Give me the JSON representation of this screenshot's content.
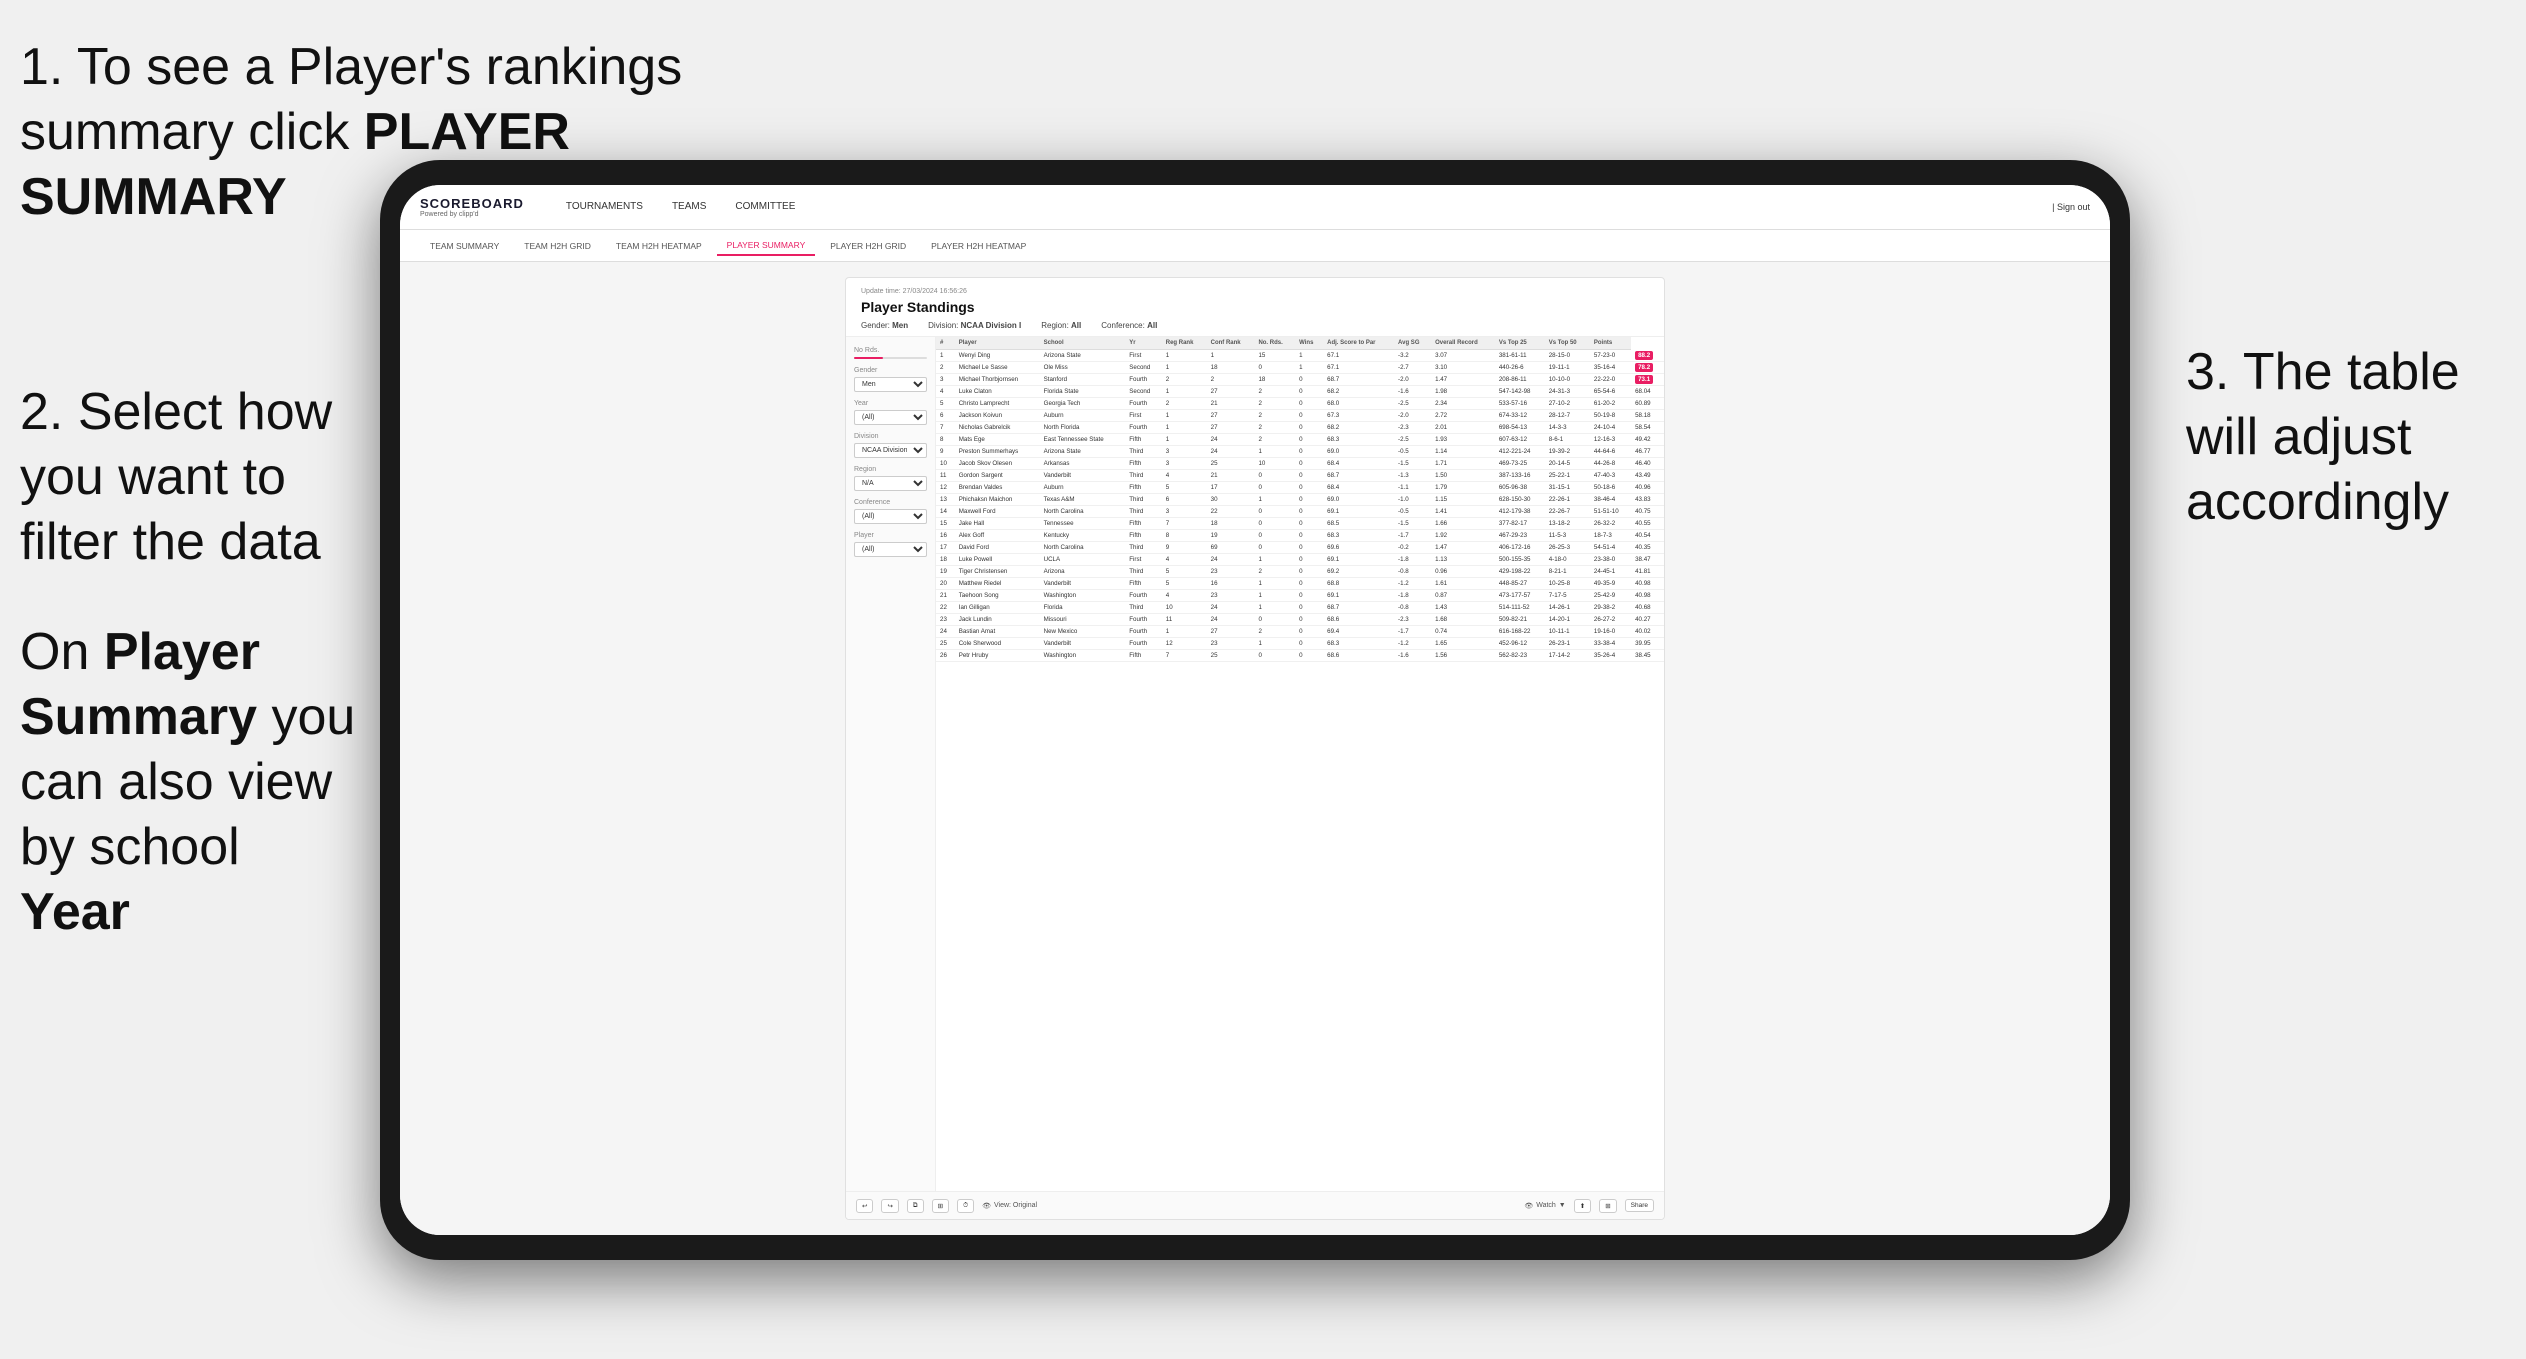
{
  "annotations": {
    "top_left": {
      "number": "1.",
      "text": "To see a Player's rankings summary click ",
      "bold": "PLAYER SUMMARY"
    },
    "mid_left": {
      "number": "2.",
      "text": "Select how you want to filter the data"
    },
    "bottom_left": {
      "text_prefix": "On ",
      "bold1": "Player Summary",
      "text_mid": " you can also view by school ",
      "bold2": "Year"
    },
    "right": {
      "number": "3.",
      "text": "The table will adjust accordingly"
    }
  },
  "app": {
    "logo": "SCOREBOARD",
    "logo_sub": "Powered by clipp'd",
    "nav": [
      {
        "label": "TOURNAMENTS",
        "active": false
      },
      {
        "label": "TEAMS",
        "active": false
      },
      {
        "label": "COMMITTEE",
        "active": false
      }
    ],
    "header_right": "| Sign out",
    "sub_nav": [
      {
        "label": "TEAM SUMMARY",
        "active": false
      },
      {
        "label": "TEAM H2H GRID",
        "active": false
      },
      {
        "label": "TEAM H2H HEATMAP",
        "active": false
      },
      {
        "label": "PLAYER SUMMARY",
        "active": true
      },
      {
        "label": "PLAYER H2H GRID",
        "active": false
      },
      {
        "label": "PLAYER H2H HEATMAP",
        "active": false
      }
    ]
  },
  "standings": {
    "update_time": "Update time:",
    "update_date": "27/03/2024 16:56:26",
    "title": "Player Standings",
    "filters": {
      "gender_label": "Gender:",
      "gender_value": "Men",
      "division_label": "Division:",
      "division_value": "NCAA Division I",
      "region_label": "Region:",
      "region_value": "All",
      "conference_label": "Conference:",
      "conference_value": "All"
    },
    "sidebar": {
      "no_rds_label": "No Rds.",
      "gender_label": "Gender",
      "gender_value": "Men",
      "year_label": "Year",
      "year_value": "(All)",
      "division_label": "Division",
      "division_value": "NCAA Division I",
      "region_label": "Region",
      "region_value": "N/A",
      "conference_label": "Conference",
      "conference_value": "(All)",
      "player_label": "Player",
      "player_value": "(All)"
    },
    "table_headers": [
      "#",
      "Player",
      "School",
      "Yr",
      "Reg Rank",
      "Conf Rank",
      "No. Rds.",
      "Wins",
      "Adj. Score to Par",
      "Avg SG",
      "Overall Record",
      "Vs Top 25",
      "Vs Top 50",
      "Points"
    ],
    "rows": [
      [
        1,
        "Wenyi Ding",
        "Arizona State",
        "First",
        1,
        1,
        15,
        1,
        "67.1",
        "-3.2",
        "3.07",
        "381-61-11",
        "28-15-0",
        "57-23-0",
        "88.2"
      ],
      [
        2,
        "Michael Le Sasse",
        "Ole Miss",
        "Second",
        1,
        18,
        0,
        1,
        "67.1",
        "-2.7",
        "3.10",
        "440-26-6",
        "19-11-1",
        "35-16-4",
        "78.2"
      ],
      [
        3,
        "Michael Thorbjornsen",
        "Stanford",
        "Fourth",
        2,
        2,
        18,
        0,
        "68.7",
        "-2.0",
        "1.47",
        "208-86-11",
        "10-10-0",
        "22-22-0",
        "73.1"
      ],
      [
        4,
        "Luke Claton",
        "Florida State",
        "Second",
        1,
        27,
        2,
        0,
        "68.2",
        "-1.6",
        "1.98",
        "547-142-98",
        "24-31-3",
        "65-54-6",
        "68.04"
      ],
      [
        5,
        "Christo Lamprecht",
        "Georgia Tech",
        "Fourth",
        2,
        21,
        2,
        0,
        "68.0",
        "-2.5",
        "2.34",
        "533-57-16",
        "27-10-2",
        "61-20-2",
        "60.89"
      ],
      [
        6,
        "Jackson Koivun",
        "Auburn",
        "First",
        1,
        27,
        2,
        0,
        "67.3",
        "-2.0",
        "2.72",
        "674-33-12",
        "28-12-7",
        "50-19-8",
        "58.18"
      ],
      [
        7,
        "Nicholas Gabrelcik",
        "North Florida",
        "Fourth",
        1,
        27,
        2,
        0,
        "68.2",
        "-2.3",
        "2.01",
        "698-54-13",
        "14-3-3",
        "24-10-4",
        "58.54"
      ],
      [
        8,
        "Mats Ege",
        "East Tennessee State",
        "Fifth",
        1,
        24,
        2,
        0,
        "68.3",
        "-2.5",
        "1.93",
        "607-63-12",
        "8-6-1",
        "12-16-3",
        "49.42"
      ],
      [
        9,
        "Preston Summerhays",
        "Arizona State",
        "Third",
        3,
        24,
        1,
        0,
        "69.0",
        "-0.5",
        "1.14",
        "412-221-24",
        "19-39-2",
        "44-64-6",
        "46.77"
      ],
      [
        10,
        "Jacob Skov Olesen",
        "Arkansas",
        "Fifth",
        3,
        25,
        10,
        0,
        "68.4",
        "-1.5",
        "1.71",
        "469-73-25",
        "20-14-5",
        "44-26-8",
        "46.40"
      ],
      [
        11,
        "Gordon Sargent",
        "Vanderbilt",
        "Third",
        4,
        21,
        0,
        0,
        "68.7",
        "-1.3",
        "1.50",
        "387-133-16",
        "25-22-1",
        "47-40-3",
        "43.49"
      ],
      [
        12,
        "Brendan Valdes",
        "Auburn",
        "Fifth",
        5,
        17,
        0,
        0,
        "68.4",
        "-1.1",
        "1.79",
        "605-96-38",
        "31-15-1",
        "50-18-6",
        "40.96"
      ],
      [
        13,
        "Phichaksn Maichon",
        "Texas A&M",
        "Third",
        6,
        30,
        1,
        0,
        "69.0",
        "-1.0",
        "1.15",
        "628-150-30",
        "22-26-1",
        "38-46-4",
        "43.83"
      ],
      [
        14,
        "Maxwell Ford",
        "North Carolina",
        "Third",
        3,
        22,
        0,
        0,
        "69.1",
        "-0.5",
        "1.41",
        "412-179-38",
        "22-26-7",
        "51-51-10",
        "40.75"
      ],
      [
        15,
        "Jake Hall",
        "Tennessee",
        "Fifth",
        7,
        18,
        0,
        0,
        "68.5",
        "-1.5",
        "1.66",
        "377-82-17",
        "13-18-2",
        "26-32-2",
        "40.55"
      ],
      [
        16,
        "Alex Goff",
        "Kentucky",
        "Fifth",
        8,
        19,
        0,
        0,
        "68.3",
        "-1.7",
        "1.92",
        "467-29-23",
        "11-5-3",
        "18-7-3",
        "40.54"
      ],
      [
        17,
        "David Ford",
        "North Carolina",
        "Third",
        9,
        69,
        0,
        0,
        "69.6",
        "-0.2",
        "1.47",
        "406-172-16",
        "26-25-3",
        "54-51-4",
        "40.35"
      ],
      [
        18,
        "Luke Powell",
        "UCLA",
        "First",
        4,
        24,
        1,
        0,
        "69.1",
        "-1.8",
        "1.13",
        "500-155-35",
        "4-18-0",
        "23-38-0",
        "38.47"
      ],
      [
        19,
        "Tiger Christensen",
        "Arizona",
        "Third",
        5,
        23,
        2,
        0,
        "69.2",
        "-0.8",
        "0.96",
        "429-198-22",
        "8-21-1",
        "24-45-1",
        "41.81"
      ],
      [
        20,
        "Matthew Riedel",
        "Vanderbilt",
        "Fifth",
        5,
        16,
        1,
        0,
        "68.8",
        "-1.2",
        "1.61",
        "448-85-27",
        "10-25-8",
        "49-35-9",
        "40.98"
      ],
      [
        21,
        "Taehoon Song",
        "Washington",
        "Fourth",
        4,
        23,
        1,
        0,
        "69.1",
        "-1.8",
        "0.87",
        "473-177-57",
        "7-17-5",
        "25-42-9",
        "40.98"
      ],
      [
        22,
        "Ian Gilligan",
        "Florida",
        "Third",
        10,
        24,
        1,
        0,
        "68.7",
        "-0.8",
        "1.43",
        "514-111-52",
        "14-26-1",
        "29-38-2",
        "40.68"
      ],
      [
        23,
        "Jack Lundin",
        "Missouri",
        "Fourth",
        11,
        24,
        0,
        0,
        "68.6",
        "-2.3",
        "1.68",
        "509-82-21",
        "14-20-1",
        "26-27-2",
        "40.27"
      ],
      [
        24,
        "Bastian Amat",
        "New Mexico",
        "Fourth",
        1,
        27,
        2,
        0,
        "69.4",
        "-1.7",
        "0.74",
        "616-168-22",
        "10-11-1",
        "19-16-0",
        "40.02"
      ],
      [
        25,
        "Cole Sherwood",
        "Vanderbilt",
        "Fourth",
        12,
        23,
        1,
        0,
        "68.3",
        "-1.2",
        "1.65",
        "452-96-12",
        "26-23-1",
        "33-38-4",
        "39.95"
      ],
      [
        26,
        "Petr Hruby",
        "Washington",
        "Fifth",
        7,
        25,
        0,
        0,
        "68.6",
        "-1.6",
        "1.56",
        "562-82-23",
        "17-14-2",
        "35-26-4",
        "38.45"
      ]
    ],
    "toolbar": {
      "view_label": "View: Original",
      "watch_label": "Watch",
      "share_label": "Share"
    }
  }
}
